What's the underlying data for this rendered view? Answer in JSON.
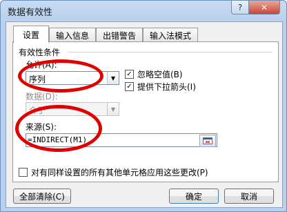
{
  "window": {
    "title": "数据有效性",
    "help_label": "?",
    "close_label": "✕"
  },
  "tabs": [
    {
      "label": "设置",
      "active": true
    },
    {
      "label": "输入信息",
      "active": false
    },
    {
      "label": "出错警告",
      "active": false
    },
    {
      "label": "输入法模式",
      "active": false
    }
  ],
  "settings": {
    "section_title": "有效性条件",
    "allow_label": "允许(A):",
    "allow_value": "序列",
    "data_label": "数据(D):",
    "data_value": "介于",
    "ignore_blank_label": "忽略空值(B)",
    "ignore_blank_checked": true,
    "dropdown_label": "提供下拉箭头(I)",
    "dropdown_checked": true,
    "source_label": "来源(S):",
    "source_value": "=INDIRECT(M1)",
    "apply_all_label": "对有同样设置的所有其他单元格应用这些更改(P)",
    "apply_all_checked": false
  },
  "footer": {
    "clear_all_label": "全部清除(C)",
    "ok_label": "确定",
    "cancel_label": "取消"
  },
  "colors": {
    "annotation": "#e00000",
    "title_bar": "#b9d1ee"
  }
}
